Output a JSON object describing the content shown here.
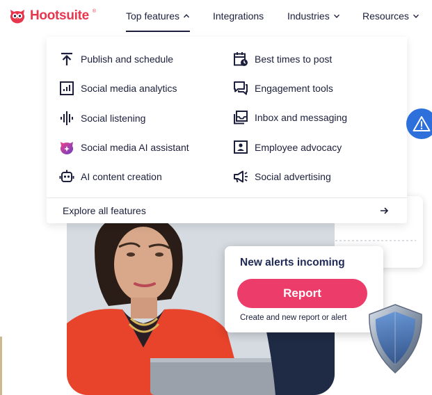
{
  "brand": {
    "name": "Hootsuite",
    "trademark": "®",
    "color": "#e8364f"
  },
  "nav": {
    "items": [
      {
        "label": "Top features",
        "state": "expanded"
      },
      {
        "label": "Integrations"
      },
      {
        "label": "Industries",
        "state": "collapsed"
      },
      {
        "label": "Resources",
        "state": "collapsed"
      }
    ]
  },
  "dropdown": {
    "left_column": [
      {
        "label": "Publish and schedule",
        "icon": "upload-arrow-icon"
      },
      {
        "label": "Social media analytics",
        "icon": "bar-chart-icon"
      },
      {
        "label": "Social listening",
        "icon": "sound-wave-icon"
      },
      {
        "label": "Social media AI assistant",
        "icon": "owly-ai-icon"
      },
      {
        "label": "AI content creation",
        "icon": "robot-icon"
      }
    ],
    "right_column": [
      {
        "label": "Best times to post",
        "icon": "calendar-clock-icon"
      },
      {
        "label": "Engagement tools",
        "icon": "chat-bubbles-icon"
      },
      {
        "label": "Inbox and messaging",
        "icon": "inbox-icon"
      },
      {
        "label": "Employee advocacy",
        "icon": "id-badge-icon"
      },
      {
        "label": "Social advertising",
        "icon": "megaphone-icon"
      }
    ],
    "explore": {
      "label": "Explore all features",
      "icon": "arrow-right-icon"
    }
  },
  "hero": {
    "alert_title": "New alerts incoming",
    "report_label": "Report",
    "alert_subtitle": "Create and new report or alert",
    "accent_color": "#ec3c6a"
  },
  "floating": {
    "icon": "warning-triangle-icon",
    "color": "#2d6fdb"
  }
}
